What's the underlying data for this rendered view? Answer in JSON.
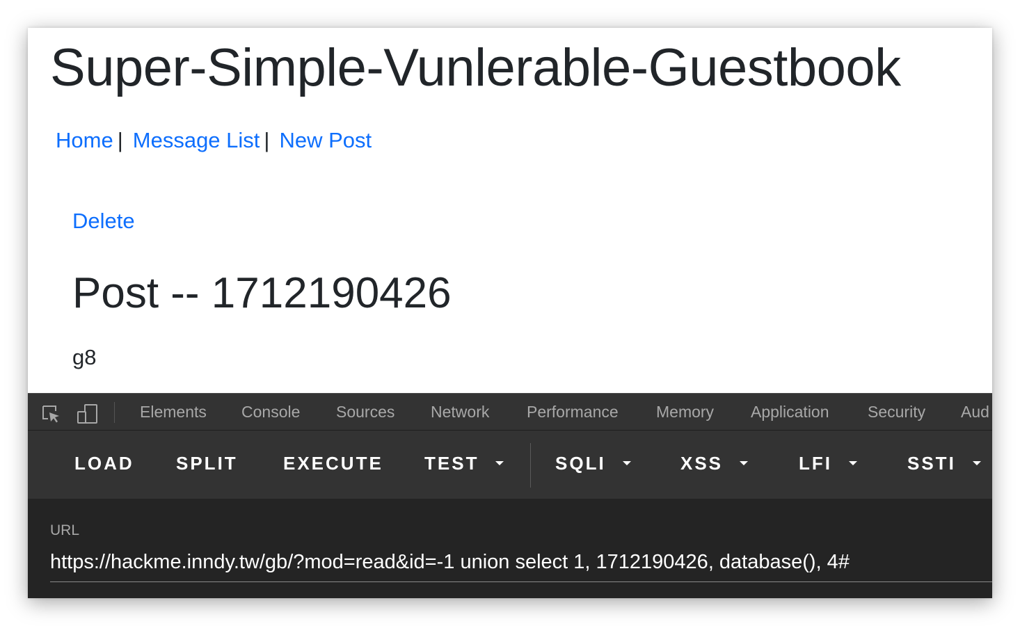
{
  "site": {
    "title": "Super-Simple-Vunlerable-Guestbook"
  },
  "nav": {
    "items": [
      {
        "label": "Home"
      },
      {
        "label": "Message List"
      },
      {
        "label": "New Post"
      }
    ],
    "separator": "|"
  },
  "post": {
    "delete_label": "Delete",
    "title": "Post -- 1712190426",
    "body": "g8"
  },
  "devtools": {
    "tabs": [
      "Elements",
      "Console",
      "Sources",
      "Network",
      "Performance",
      "Memory",
      "Application",
      "Security",
      "Aud"
    ],
    "icons": [
      "inspect-element-icon",
      "device-toolbar-icon"
    ]
  },
  "hackbar": {
    "buttons": {
      "load": "LOAD",
      "split": "SPLIT",
      "execute": "EXECUTE",
      "test": "TEST",
      "sqli": "SQLI",
      "xss": "XSS",
      "lfi": "LFI",
      "ssti": "SSTI"
    },
    "url_label": "URL",
    "url_value": "https://hackme.inndy.tw/gb/?mod=read&id=-1 union select 1, 1712190426, database(), 4#"
  },
  "colors": {
    "link": "#0d6efd",
    "text": "#212529",
    "devtools_bg": "#242424",
    "devtools_bar": "#333333",
    "tab_text": "#a8a8a8"
  }
}
